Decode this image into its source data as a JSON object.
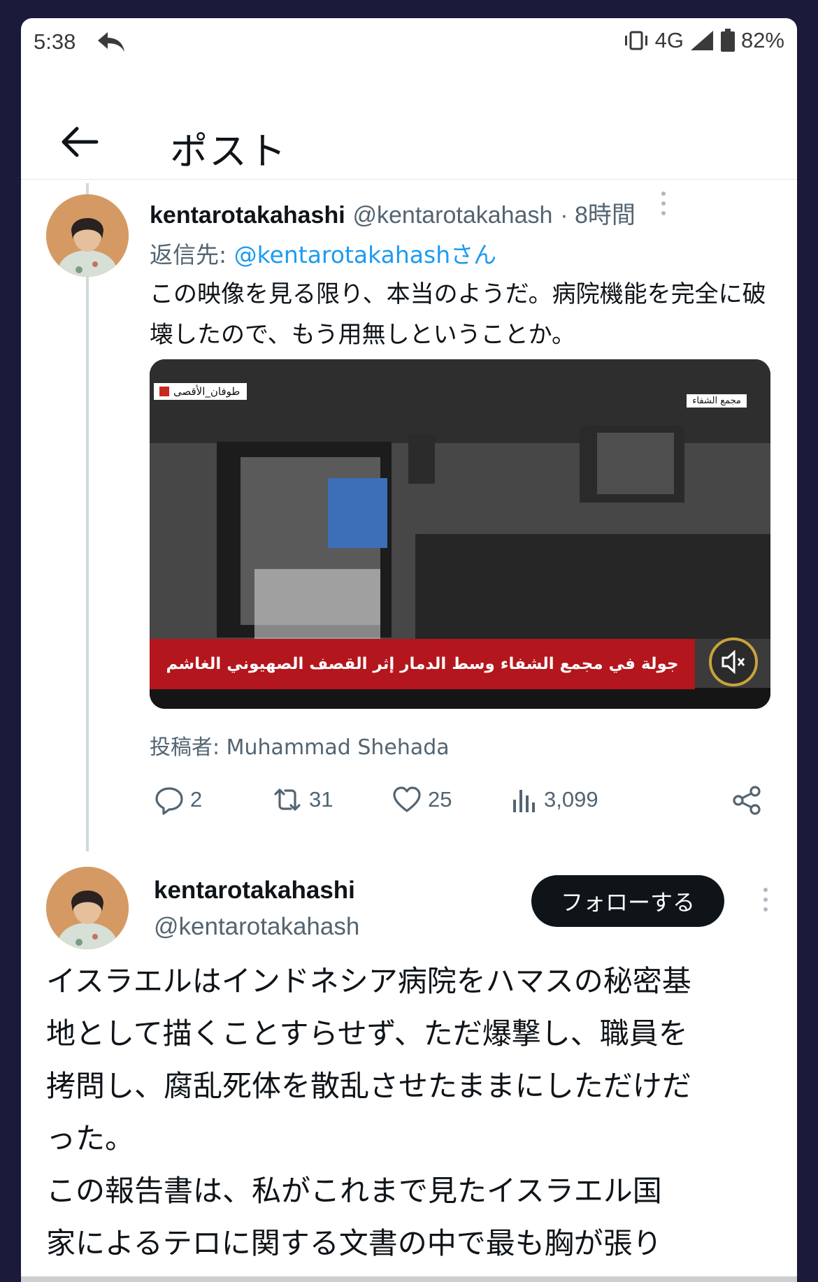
{
  "status_bar": {
    "time": "5:38",
    "network": "4G",
    "battery": "82%"
  },
  "header": {
    "title": "ポスト"
  },
  "tweet": {
    "author_name": "kentarotakahashi",
    "author_handle": "@kentarotakahash",
    "time_ago": "· 8時間",
    "reply_label": "返信先: ",
    "reply_to": "@kentarotakahashさん",
    "text": "この映像を見る限り、本当のようだ。病院機能を完全に破壊したので、もう用無しということか。",
    "media": {
      "tag_left": "طوفان_الأقصى",
      "tag_right": "مجمع الشفاء",
      "banner": "جولة في مجمع الشفاء وسط الدمار إثر القصف الصهيوني الغاشم"
    },
    "credit": "投稿者: Muhammad Shehada",
    "stats": {
      "replies": "2",
      "reposts": "31",
      "likes": "25",
      "views": "3,099"
    }
  },
  "main_tweet": {
    "author_name": "kentarotakahashi",
    "author_handle": "@kentarotakahash",
    "follow_label": "フォローする",
    "text_lines": [
      "イスラエルはインドネシア病院をハマスの秘密基",
      "地として描くことすらせず、ただ爆撃し、職員を",
      "拷問し、腐乱死体を散乱させたままにしただけだ",
      "った。",
      "この報告書は、私がこれまで見たイスラエル国",
      "家によるテロに関する文書の中で最も胸が張り"
    ]
  },
  "colors": {
    "accent": "#1d9bf0",
    "text": "#0f1419",
    "secondary": "#536471",
    "banner_red": "#b3161c",
    "background": "#1b1a3a"
  }
}
